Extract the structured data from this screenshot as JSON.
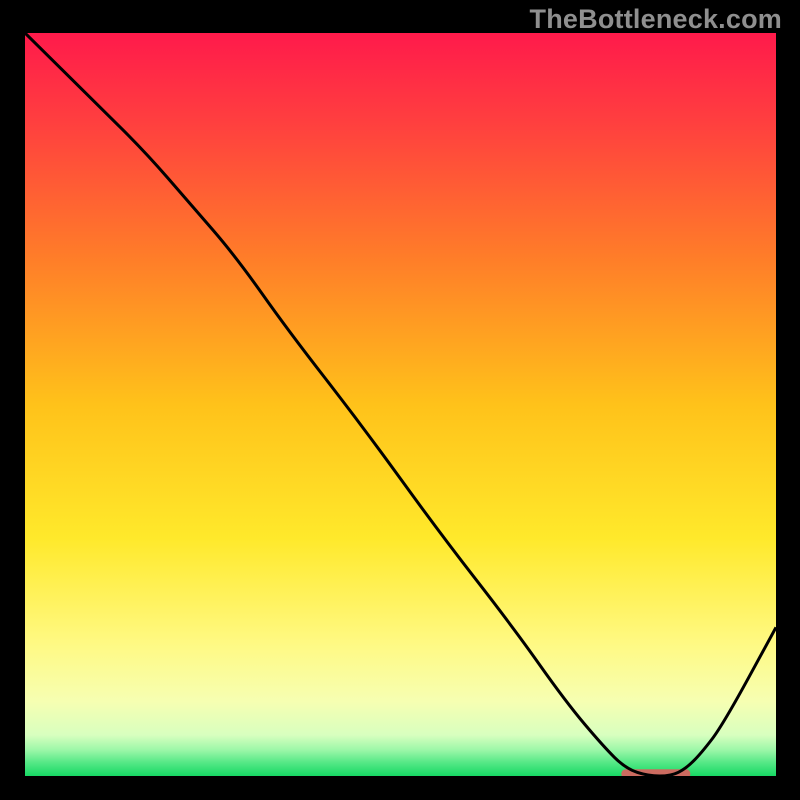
{
  "watermark": "TheBottleneck.com",
  "chart_data": {
    "type": "line",
    "title": "",
    "xlabel": "",
    "ylabel": "",
    "xlim": [
      0,
      100
    ],
    "ylim": [
      0,
      100
    ],
    "x": [
      0,
      9,
      16,
      22,
      28,
      35,
      45,
      55,
      65,
      72,
      77,
      80,
      83,
      86,
      88,
      90,
      93,
      100
    ],
    "values": [
      100,
      91,
      84,
      77,
      70,
      60,
      47,
      33,
      20,
      10,
      4,
      1,
      0,
      0,
      1,
      3,
      7,
      20
    ],
    "background_gradient": {
      "stops": [
        {
          "offset": 0.0,
          "color": "#ff1a4b"
        },
        {
          "offset": 0.12,
          "color": "#ff3f3f"
        },
        {
          "offset": 0.3,
          "color": "#ff7c29"
        },
        {
          "offset": 0.5,
          "color": "#ffc21a"
        },
        {
          "offset": 0.68,
          "color": "#ffe92b"
        },
        {
          "offset": 0.82,
          "color": "#fff982"
        },
        {
          "offset": 0.9,
          "color": "#f6ffb2"
        },
        {
          "offset": 0.945,
          "color": "#d8ffbf"
        },
        {
          "offset": 0.965,
          "color": "#9cf7a8"
        },
        {
          "offset": 0.982,
          "color": "#55e886"
        },
        {
          "offset": 1.0,
          "color": "#17d964"
        }
      ]
    },
    "marker": {
      "x_start": 80,
      "x_end": 88,
      "y": 0.3,
      "color": "#cc6b60",
      "thickness": 9
    },
    "line_color": "#000000",
    "line_width": 3
  }
}
